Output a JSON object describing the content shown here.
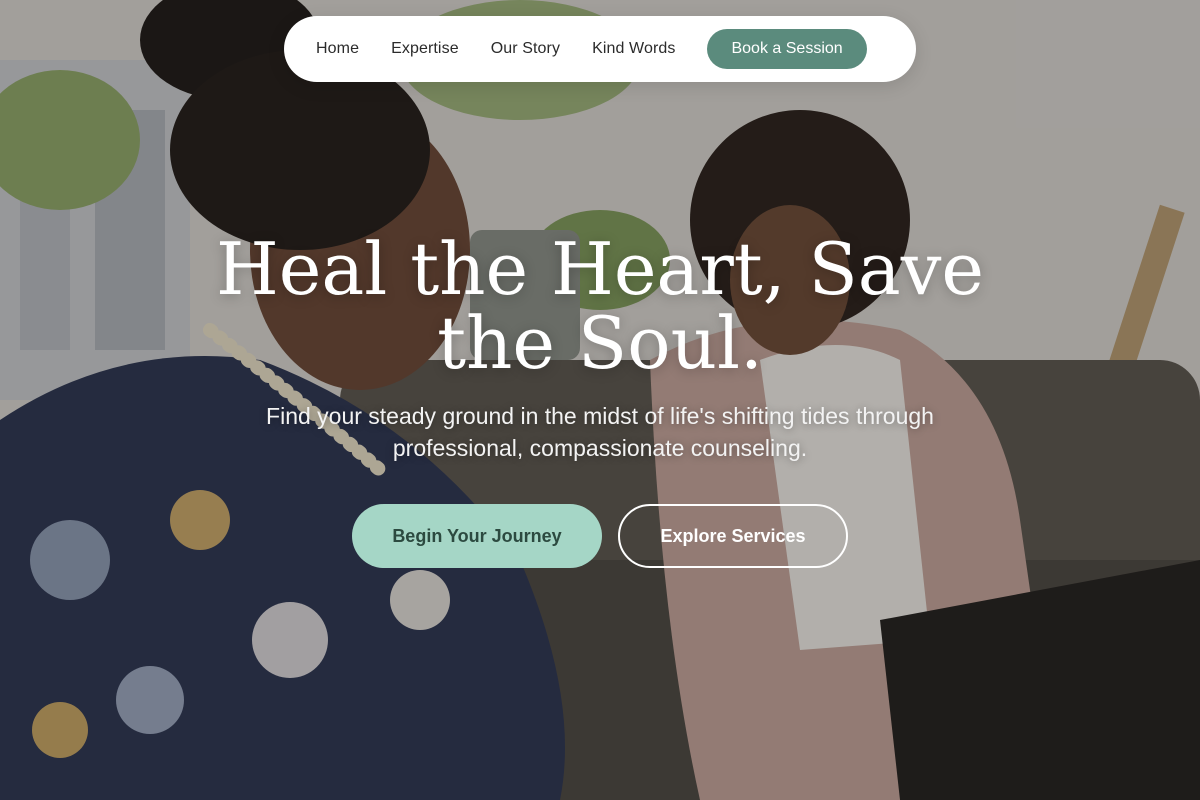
{
  "nav": {
    "links": [
      {
        "label": "Home"
      },
      {
        "label": "Expertise"
      },
      {
        "label": "Our Story"
      },
      {
        "label": "Kind Words"
      }
    ],
    "cta_label": "Book a Session"
  },
  "hero": {
    "title": "Heal the Heart, Save the Soul.",
    "subtitle": "Find your steady ground in the midst of life's shifting tides through professional, compassionate counseling.",
    "primary_button": "Begin Your Journey",
    "secondary_button": "Explore Services"
  },
  "colors": {
    "nav_cta_bg": "#5b8b7d",
    "primary_button_bg": "#a5d6c6",
    "primary_button_text": "#2c4a40"
  },
  "background_image": "counseling-session-photo"
}
